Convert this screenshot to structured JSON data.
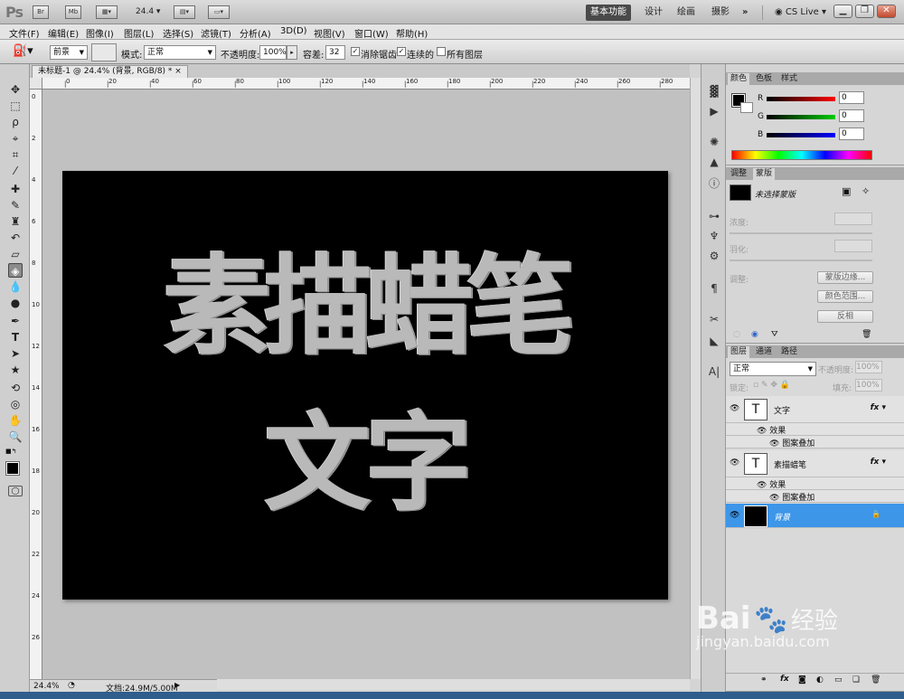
{
  "app": {
    "logo": "Ps",
    "zoom": "24.4",
    "icons": [
      "bridge-icon",
      "minibridge-icon",
      "view-extras-icon",
      "arrange-docs-icon",
      "screen-mode-icon"
    ]
  },
  "titlebar": {
    "br": "Br",
    "mb": "Mb",
    "workspaces": [
      "基本功能",
      "设计",
      "绘画",
      "摄影"
    ],
    "more": "»",
    "cslive": "CS Live"
  },
  "menu": [
    "文件(F)",
    "编辑(E)",
    "图像(I)",
    "图层(L)",
    "选择(S)",
    "滤镜(T)",
    "分析(A)",
    "3D(D)",
    "视图(V)",
    "窗口(W)",
    "帮助(H)"
  ],
  "options": {
    "fill_source": "前景",
    "mode_label": "模式:",
    "mode_value": "正常",
    "opacity_label": "不透明度:",
    "opacity_value": "100%",
    "tolerance_label": "容差:",
    "tolerance_value": "32",
    "antialias": "消除锯齿",
    "contiguous": "连续的",
    "all_layers": "所有图层"
  },
  "document": {
    "tab_title": "未标题-1 @ 24.4% (背景, RGB/8) *",
    "close": "×",
    "text_line1": "素描蜡笔",
    "text_line2": "文字",
    "ruler_h": [
      "0",
      "20",
      "40",
      "60",
      "80",
      "100",
      "120",
      "140",
      "160",
      "180",
      "200",
      "220",
      "240",
      "260",
      "280",
      "300"
    ],
    "ruler_v": [
      "0",
      "2",
      "4",
      "6",
      "8",
      "10",
      "12",
      "14",
      "16",
      "18",
      "20",
      "22",
      "24",
      "26"
    ]
  },
  "status": {
    "zoom": "24.4%",
    "doc": "文档:24.9M/5.00M"
  },
  "color_panel": {
    "tabs": [
      "颜色",
      "色板",
      "样式"
    ],
    "channels": [
      {
        "name": "R",
        "value": "0"
      },
      {
        "name": "G",
        "value": "0"
      },
      {
        "name": "B",
        "value": "0"
      }
    ]
  },
  "adjust_panel": {
    "tabs": [
      "调整",
      "蒙版"
    ],
    "no_mask": "未选择蒙版",
    "density": "浓度:",
    "feather": "羽化:",
    "refine": "调整:",
    "btn_edge": "蒙版边缘...",
    "btn_range": "颜色范围...",
    "btn_invert": "反相"
  },
  "layers_panel": {
    "tabs": [
      "图层",
      "通道",
      "路径"
    ],
    "blend": "正常",
    "opacity_label": "不透明度:",
    "opacity_value": "100%",
    "lock_label": "锁定:",
    "fill_label": "填充:",
    "fill_value": "100%",
    "layers": [
      {
        "name": "文字",
        "effects": "效果",
        "effect_item": "图案叠加"
      },
      {
        "name": "素描蜡笔",
        "effects": "效果",
        "effect_item": "图案叠加"
      },
      {
        "name": "背景"
      }
    ]
  },
  "watermark": {
    "brand": "Bai",
    "brand2": "经验",
    "url": "jingyan.baidu.com"
  },
  "colors": {
    "accent": "#3d8ee6",
    "selected_layer": "#3d96e8",
    "canvas": "#000000",
    "text": "#b9b9b9"
  }
}
